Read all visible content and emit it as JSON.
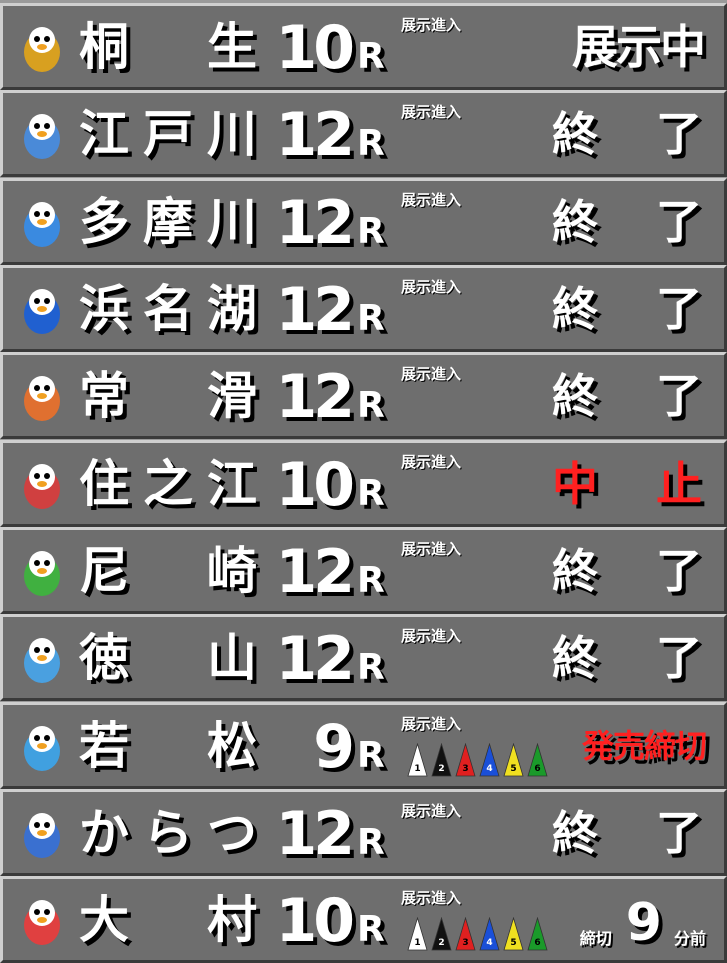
{
  "exhibit_label": "展示進入",
  "rows": [
    {
      "venue": [
        "桐",
        "生"
      ],
      "race": "10",
      "r": "R",
      "status": [
        "展示中"
      ],
      "status_kind": "live",
      "icon": "kiryu-mascot-icon"
    },
    {
      "venue": [
        "江",
        "戸",
        "川"
      ],
      "race": "12",
      "r": "R",
      "status": [
        "終",
        "了"
      ],
      "status_kind": "done",
      "icon": "edogawa-mascot-icon"
    },
    {
      "venue": [
        "多",
        "摩",
        "川"
      ],
      "race": "12",
      "r": "R",
      "status": [
        "終",
        "了"
      ],
      "status_kind": "done",
      "icon": "tamagawa-mascot-icon"
    },
    {
      "venue": [
        "浜",
        "名",
        "湖"
      ],
      "race": "12",
      "r": "R",
      "status": [
        "終",
        "了"
      ],
      "status_kind": "done",
      "icon": "hamanako-mascot-icon"
    },
    {
      "venue": [
        "常",
        "滑"
      ],
      "race": "12",
      "r": "R",
      "status": [
        "終",
        "了"
      ],
      "status_kind": "done",
      "icon": "tokoname-mascot-icon"
    },
    {
      "venue": [
        "住",
        "之",
        "江"
      ],
      "race": "10",
      "r": "R",
      "status": [
        "中",
        "止"
      ],
      "status_kind": "cancel",
      "icon": "suminoe-mascot-icon"
    },
    {
      "venue": [
        "尼",
        "崎"
      ],
      "race": "12",
      "r": "R",
      "status": [
        "終",
        "了"
      ],
      "status_kind": "done",
      "icon": "amagasaki-mascot-icon"
    },
    {
      "venue": [
        "徳",
        "山"
      ],
      "race": "12",
      "r": "R",
      "status": [
        "終",
        "了"
      ],
      "status_kind": "done",
      "icon": "tokuyama-mascot-icon"
    },
    {
      "venue": [
        "若",
        "松"
      ],
      "race": "9",
      "r": "R",
      "status": [
        "発売締切"
      ],
      "status_kind": "closed",
      "icon": "wakamatsu-mascot-icon",
      "cones": [
        "1",
        "2",
        "3",
        "4",
        "5",
        "6"
      ]
    },
    {
      "venue": [
        "か",
        "ら",
        "つ"
      ],
      "race": "12",
      "r": "R",
      "status": [
        "終",
        "了"
      ],
      "status_kind": "done",
      "icon": "karatsu-mascot-icon"
    },
    {
      "venue": [
        "大",
        "村"
      ],
      "race": "10",
      "r": "R",
      "status_kind": "countdown",
      "icon": "omura-mascot-icon",
      "cones": [
        "1",
        "2",
        "3",
        "4",
        "5",
        "6"
      ],
      "countdown": {
        "label": "締切",
        "minutes": "9",
        "unit": "分前"
      }
    }
  ],
  "cone_colors": [
    "#ffffff",
    "#111111",
    "#e02020",
    "#1a4fd8",
    "#f0e020",
    "#1a9a2a"
  ],
  "cone_text_colors": [
    "#000000",
    "#ffffff",
    "#000000",
    "#ffffff",
    "#000000",
    "#000000"
  ],
  "mascot_colors": [
    "#d8a020",
    "#4a8ad8",
    "#3a8ae0",
    "#2060d0",
    "#e07030",
    "#d04040",
    "#40b040",
    "#4aa0e0",
    "#40a0e0",
    "#3a70d0",
    "#e04040"
  ]
}
